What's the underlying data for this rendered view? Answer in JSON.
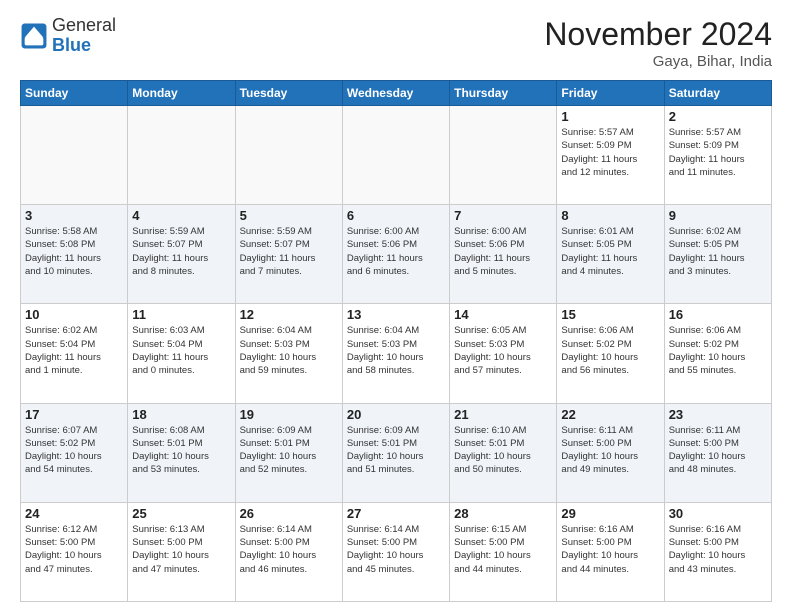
{
  "header": {
    "logo": {
      "general": "General",
      "blue": "Blue"
    },
    "month_year": "November 2024",
    "location": "Gaya, Bihar, India"
  },
  "weekdays": [
    "Sunday",
    "Monday",
    "Tuesday",
    "Wednesday",
    "Thursday",
    "Friday",
    "Saturday"
  ],
  "weeks": [
    [
      {
        "day": "",
        "info": ""
      },
      {
        "day": "",
        "info": ""
      },
      {
        "day": "",
        "info": ""
      },
      {
        "day": "",
        "info": ""
      },
      {
        "day": "",
        "info": ""
      },
      {
        "day": "1",
        "info": "Sunrise: 5:57 AM\nSunset: 5:09 PM\nDaylight: 11 hours\nand 12 minutes."
      },
      {
        "day": "2",
        "info": "Sunrise: 5:57 AM\nSunset: 5:09 PM\nDaylight: 11 hours\nand 11 minutes."
      }
    ],
    [
      {
        "day": "3",
        "info": "Sunrise: 5:58 AM\nSunset: 5:08 PM\nDaylight: 11 hours\nand 10 minutes."
      },
      {
        "day": "4",
        "info": "Sunrise: 5:59 AM\nSunset: 5:07 PM\nDaylight: 11 hours\nand 8 minutes."
      },
      {
        "day": "5",
        "info": "Sunrise: 5:59 AM\nSunset: 5:07 PM\nDaylight: 11 hours\nand 7 minutes."
      },
      {
        "day": "6",
        "info": "Sunrise: 6:00 AM\nSunset: 5:06 PM\nDaylight: 11 hours\nand 6 minutes."
      },
      {
        "day": "7",
        "info": "Sunrise: 6:00 AM\nSunset: 5:06 PM\nDaylight: 11 hours\nand 5 minutes."
      },
      {
        "day": "8",
        "info": "Sunrise: 6:01 AM\nSunset: 5:05 PM\nDaylight: 11 hours\nand 4 minutes."
      },
      {
        "day": "9",
        "info": "Sunrise: 6:02 AM\nSunset: 5:05 PM\nDaylight: 11 hours\nand 3 minutes."
      }
    ],
    [
      {
        "day": "10",
        "info": "Sunrise: 6:02 AM\nSunset: 5:04 PM\nDaylight: 11 hours\nand 1 minute."
      },
      {
        "day": "11",
        "info": "Sunrise: 6:03 AM\nSunset: 5:04 PM\nDaylight: 11 hours\nand 0 minutes."
      },
      {
        "day": "12",
        "info": "Sunrise: 6:04 AM\nSunset: 5:03 PM\nDaylight: 10 hours\nand 59 minutes."
      },
      {
        "day": "13",
        "info": "Sunrise: 6:04 AM\nSunset: 5:03 PM\nDaylight: 10 hours\nand 58 minutes."
      },
      {
        "day": "14",
        "info": "Sunrise: 6:05 AM\nSunset: 5:03 PM\nDaylight: 10 hours\nand 57 minutes."
      },
      {
        "day": "15",
        "info": "Sunrise: 6:06 AM\nSunset: 5:02 PM\nDaylight: 10 hours\nand 56 minutes."
      },
      {
        "day": "16",
        "info": "Sunrise: 6:06 AM\nSunset: 5:02 PM\nDaylight: 10 hours\nand 55 minutes."
      }
    ],
    [
      {
        "day": "17",
        "info": "Sunrise: 6:07 AM\nSunset: 5:02 PM\nDaylight: 10 hours\nand 54 minutes."
      },
      {
        "day": "18",
        "info": "Sunrise: 6:08 AM\nSunset: 5:01 PM\nDaylight: 10 hours\nand 53 minutes."
      },
      {
        "day": "19",
        "info": "Sunrise: 6:09 AM\nSunset: 5:01 PM\nDaylight: 10 hours\nand 52 minutes."
      },
      {
        "day": "20",
        "info": "Sunrise: 6:09 AM\nSunset: 5:01 PM\nDaylight: 10 hours\nand 51 minutes."
      },
      {
        "day": "21",
        "info": "Sunrise: 6:10 AM\nSunset: 5:01 PM\nDaylight: 10 hours\nand 50 minutes."
      },
      {
        "day": "22",
        "info": "Sunrise: 6:11 AM\nSunset: 5:00 PM\nDaylight: 10 hours\nand 49 minutes."
      },
      {
        "day": "23",
        "info": "Sunrise: 6:11 AM\nSunset: 5:00 PM\nDaylight: 10 hours\nand 48 minutes."
      }
    ],
    [
      {
        "day": "24",
        "info": "Sunrise: 6:12 AM\nSunset: 5:00 PM\nDaylight: 10 hours\nand 47 minutes."
      },
      {
        "day": "25",
        "info": "Sunrise: 6:13 AM\nSunset: 5:00 PM\nDaylight: 10 hours\nand 47 minutes."
      },
      {
        "day": "26",
        "info": "Sunrise: 6:14 AM\nSunset: 5:00 PM\nDaylight: 10 hours\nand 46 minutes."
      },
      {
        "day": "27",
        "info": "Sunrise: 6:14 AM\nSunset: 5:00 PM\nDaylight: 10 hours\nand 45 minutes."
      },
      {
        "day": "28",
        "info": "Sunrise: 6:15 AM\nSunset: 5:00 PM\nDaylight: 10 hours\nand 44 minutes."
      },
      {
        "day": "29",
        "info": "Sunrise: 6:16 AM\nSunset: 5:00 PM\nDaylight: 10 hours\nand 44 minutes."
      },
      {
        "day": "30",
        "info": "Sunrise: 6:16 AM\nSunset: 5:00 PM\nDaylight: 10 hours\nand 43 minutes."
      }
    ]
  ]
}
